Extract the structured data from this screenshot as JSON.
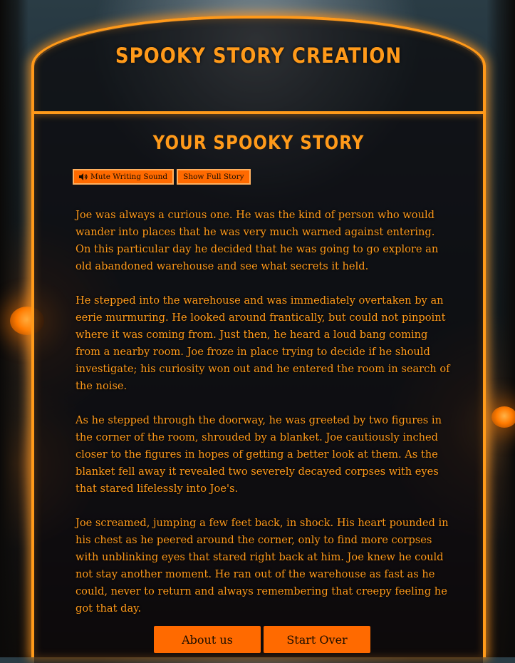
{
  "header": {
    "title": "Spooky Story Creation"
  },
  "story_section": {
    "heading": "Your Spooky Story",
    "mute_button_label": "Mute Writing Sound",
    "show_full_button_label": "Show Full Story",
    "paragraphs": [
      "Joe was always a curious one. He was the kind of person who would wander into places that he was very much warned against entering. On this particular day he decided that he was going to go explore an old abandoned warehouse and see what secrets it held.",
      "He stepped into the warehouse and was immediately overtaken by an eerie murmuring. He looked around frantically, but could not pinpoint where it was coming from. Just then, he heard a loud bang coming from a nearby room. Joe froze in place trying to decide if he should investigate; his curiosity won out and he entered the room in search of the noise.",
      "As he stepped through the doorway, he was greeted by two figures in the corner of the room, shrouded by a blanket. Joe cautiously inched closer to the figures in hopes of getting a better look at them. As the blanket fell away it revealed two severely decayed corpses with eyes that stared lifelessly into Joe's.",
      "Joe screamed, jumping a few feet back, in shock. His heart pounded in his chest as he peered around the corner, only to find more corpses with unblinking eyes that stared right back at him. Joe knew he could not stay another moment. He ran out of the warehouse as fast as he could, never to return and always remembering that creepy feeling he got that day."
    ]
  },
  "footer": {
    "about_label": "About us",
    "start_over_label": "Start Over"
  },
  "colors": {
    "accent": "#ff9a1a",
    "button": "#ff6a00"
  },
  "icons": {
    "mute": "speaker-icon"
  }
}
